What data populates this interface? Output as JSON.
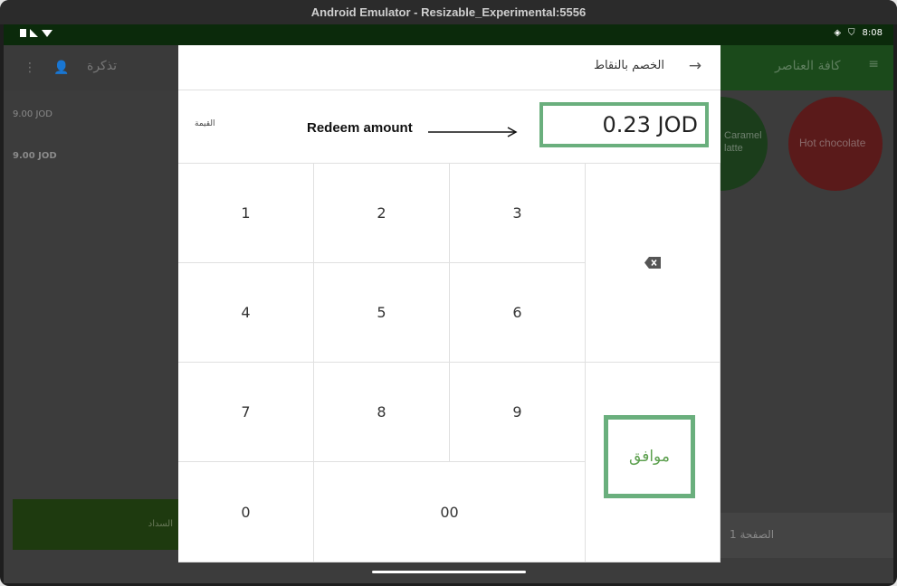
{
  "window": {
    "title": "Android Emulator - Resizable_Experimental:5556"
  },
  "statusbar": {
    "time": "8:08"
  },
  "background_app": {
    "left_header": {
      "ticket_label": "تذكرة"
    },
    "order_lines": [
      "9.00 JOD",
      "9.00 JOD"
    ],
    "pay_button_label": "السداد",
    "right_header": {
      "category_label": "كافة العناصر"
    },
    "products": [
      {
        "name": "Hot chocolate",
        "color": "#c62828"
      },
      {
        "name": "Caramel\nlatte",
        "color": "#2e7d32"
      }
    ],
    "page_label": "الصفحة 1"
  },
  "dialog": {
    "title": "الخصم بالنقاط",
    "value_label": "القيمة",
    "amount": "0.23 JOD",
    "annotation": "Redeem amount",
    "keys": {
      "k1": "1",
      "k2": "2",
      "k3": "3",
      "k4": "4",
      "k5": "5",
      "k6": "6",
      "k7": "7",
      "k8": "8",
      "k9": "9",
      "k0": "0",
      "k00": "00"
    },
    "ok_label": "موافق",
    "highlight_color": "#6aaf7d"
  }
}
